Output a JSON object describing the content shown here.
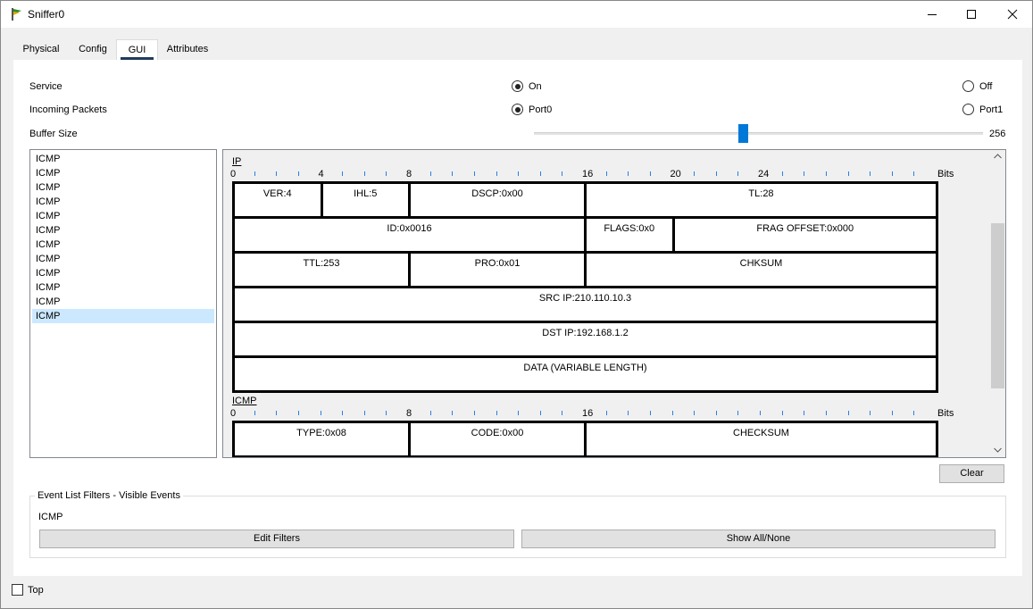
{
  "window": {
    "title": "Sniffer0",
    "controls": [
      "minimize",
      "maximize",
      "close"
    ]
  },
  "tabs": [
    {
      "label": "Physical",
      "active": false
    },
    {
      "label": "Config",
      "active": false
    },
    {
      "label": "GUI",
      "active": true
    },
    {
      "label": "Attributes",
      "active": false
    }
  ],
  "service": {
    "label": "Service",
    "on_label": "On",
    "off_label": "Off",
    "selected": "On"
  },
  "incoming": {
    "label": "Incoming Packets",
    "port0_label": "Port0",
    "port1_label": "Port1",
    "selected": "Port0"
  },
  "buffer": {
    "label": "Buffer Size",
    "value": "256",
    "slider_fraction": 0.47
  },
  "pdu_list": {
    "items": [
      "ICMP",
      "ICMP",
      "ICMP",
      "ICMP",
      "ICMP",
      "ICMP",
      "ICMP",
      "ICMP",
      "ICMP",
      "ICMP",
      "ICMP",
      "ICMP"
    ],
    "selected_index": 11
  },
  "ip_section": {
    "title": "IP",
    "ruler_labels": [
      "0",
      "4",
      "8",
      "16",
      "20",
      "24",
      "Bits"
    ],
    "rows": [
      [
        "VER:4",
        "IHL:5",
        "DSCP:0x00",
        "TL:28"
      ],
      [
        "ID:0x0016",
        "FLAGS:0x0",
        "FRAG OFFSET:0x000"
      ],
      [
        "TTL:253",
        "PRO:0x01",
        "CHKSUM"
      ],
      [
        "SRC IP:210.110.10.3"
      ],
      [
        "DST IP:192.168.1.2"
      ],
      [
        "DATA (VARIABLE LENGTH)"
      ]
    ]
  },
  "icmp_section": {
    "title": "ICMP",
    "ruler_labels": [
      "0",
      "8",
      "16",
      "Bits"
    ],
    "rows": [
      [
        "TYPE:0x08",
        "CODE:0x00",
        "CHECKSUM"
      ]
    ]
  },
  "clear_button": "Clear",
  "filters": {
    "legend": "Event List Filters - Visible Events",
    "value": "ICMP",
    "edit_button": "Edit Filters",
    "show_button": "Show All/None"
  },
  "top_checkbox": {
    "label": "Top",
    "checked": false
  }
}
